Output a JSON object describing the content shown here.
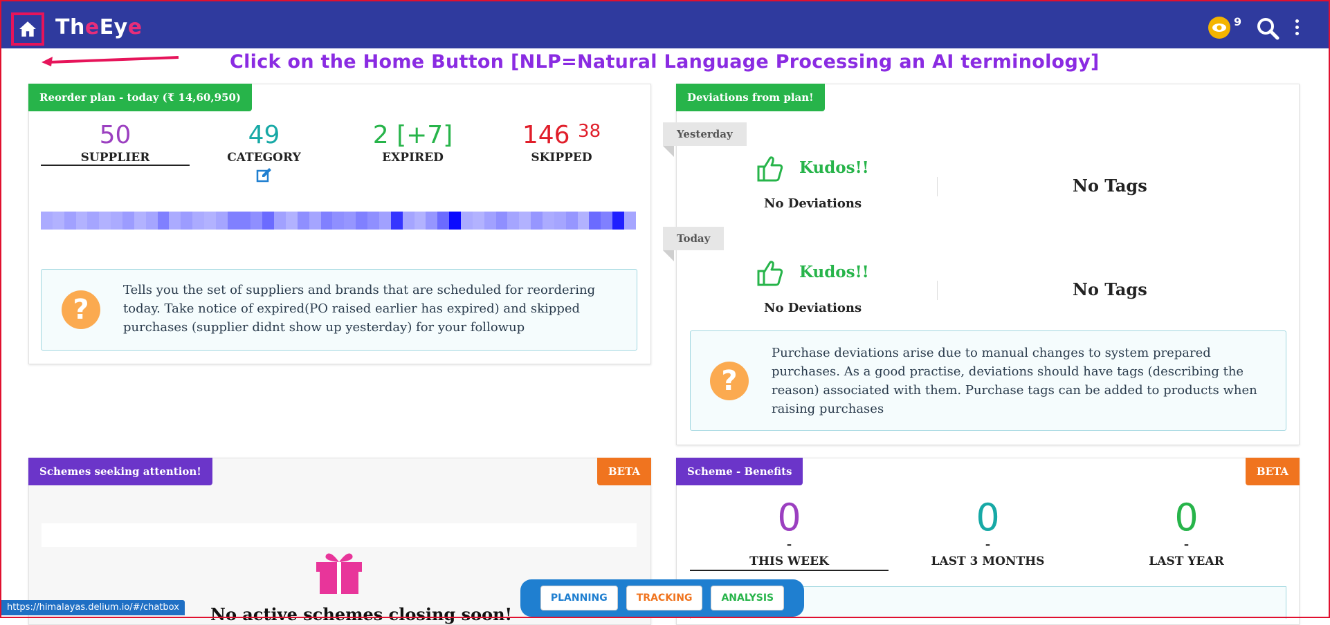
{
  "header": {
    "logo_parts": [
      "Th",
      "e",
      "Ey",
      "e"
    ],
    "notification_count": "9"
  },
  "annotation": {
    "text": "Click on the Home Button [NLP=Natural Language Processing an AI terminology]"
  },
  "reorder": {
    "title": "Reorder plan - today (₹ 14,60,950)",
    "stats": [
      {
        "value": "50",
        "sup": "",
        "label": "SUPPLIER",
        "color": "#9b3fc0"
      },
      {
        "value": "49",
        "sup": "",
        "label": "CATEGORY",
        "color": "#17a9a6"
      },
      {
        "value": "2 [+7]",
        "sup": "",
        "label": "EXPIRED",
        "color": "#27b44a"
      },
      {
        "value": "146",
        "sup": "38",
        "label": "SKIPPED",
        "color": "#e01e2a"
      }
    ],
    "heat_levels": [
      0.25,
      0.22,
      0.3,
      0.22,
      0.28,
      0.22,
      0.25,
      0.32,
      0.22,
      0.28,
      0.45,
      0.25,
      0.32,
      0.25,
      0.22,
      0.28,
      0.45,
      0.45,
      0.38,
      0.55,
      0.3,
      0.22,
      0.38,
      0.28,
      0.45,
      0.38,
      0.35,
      0.45,
      0.38,
      0.3,
      0.8,
      0.28,
      0.22,
      0.35,
      0.55,
      1.0,
      0.25,
      0.22,
      0.3,
      0.38,
      0.28,
      0.22,
      0.35,
      0.25,
      0.28,
      0.35,
      0.22,
      0.55,
      0.45,
      0.9,
      0.28
    ],
    "help": "Tells you the set of suppliers and brands that are scheduled for reordering today. Take notice of expired(PO raised earlier has expired) and skipped purchases (supplier didnt show up yesterday) for your followup"
  },
  "deviations": {
    "title": "Deviations from plan!",
    "days": [
      {
        "label": "Yesterday",
        "kudos": "Kudos!!",
        "status": "No Deviations",
        "tags": "No Tags"
      },
      {
        "label": "Today",
        "kudos": "Kudos!!",
        "status": "No Deviations",
        "tags": "No Tags"
      }
    ],
    "help": "Purchase deviations arise due to manual changes to system prepared purchases. As a good practise, deviations should have tags (describing the reason) associated with them. Purchase tags can be added to products when raising purchases"
  },
  "schemes": {
    "title": "Schemes seeking attention!",
    "beta": "BETA",
    "empty_text": "No active schemes closing soon!"
  },
  "scheme_benefits": {
    "title": "Scheme - Benefits",
    "beta": "BETA",
    "stats": [
      {
        "value": "0",
        "dash": "-",
        "label": "THIS WEEK",
        "color": "#9b3fc0"
      },
      {
        "value": "0",
        "dash": "-",
        "label": "LAST 3 MONTHS",
        "color": "#17a9a6"
      },
      {
        "value": "0",
        "dash": "-",
        "label": "LAST YEAR",
        "color": "#27b44a"
      }
    ]
  },
  "bottom_tabs": [
    {
      "label": "PLANNING",
      "color": "#1f7fd0"
    },
    {
      "label": "TRACKING",
      "color": "#f0741f"
    },
    {
      "label": "ANALYSIS",
      "color": "#27b44a"
    }
  ],
  "status_url": "https://himalayas.delium.io/#/chatbox"
}
